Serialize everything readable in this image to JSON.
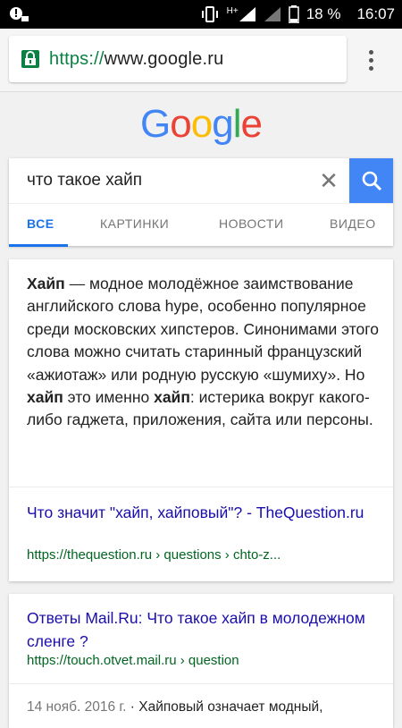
{
  "status_bar": {
    "icons": [
      "notification-icon",
      "vibrate-icon",
      "signal-icon",
      "wifi-icon",
      "battery-icon"
    ],
    "network": "H+",
    "battery": "18 %",
    "time": "16:07"
  },
  "browser": {
    "url_scheme": "https://",
    "url_host": "www.google.ru",
    "lock_color": "#0b8043"
  },
  "logo": {
    "letters": [
      "G",
      "o",
      "o",
      "g",
      "l",
      "e"
    ],
    "colors": [
      "#4285f4",
      "#ea4335",
      "#fbbc05",
      "#4285f4",
      "#34a853",
      "#ea4335"
    ]
  },
  "search": {
    "query": "что такое хайп",
    "clear_symbol": "✕",
    "accent": "#4285f4",
    "tabs": [
      {
        "label": "ВСЕ",
        "active": true
      },
      {
        "label": "КАРТИНКИ",
        "active": false
      },
      {
        "label": "НОВОСТИ",
        "active": false
      },
      {
        "label": "ВИДЕО",
        "active": false
      }
    ]
  },
  "results": {
    "snippet": {
      "term": "Хайп",
      "text1": " — модное молодёжное заимствование английского слова hype, особенно популярное среди московских хипстеров. Синонимами этого слова можно считать старинный французский «ажиотаж» или родную русскую «шумиху». Но ",
      "term2": "хайп",
      "text2": " это именно ",
      "term3": "хайп",
      "text3": ": истерика вокруг какого-либо гаджета, приложения, сайта или персоны."
    },
    "items": [
      {
        "title": "Что значит \"хайп, хайповый\"? - TheQuestion.ru",
        "url": "https://thequestion.ru › questions › chto-z..."
      },
      {
        "title": "Ответы Mail.Ru: Что такое хайп в молодежном сленге ?",
        "url": "https://touch.otvet.mail.ru › question",
        "date": "14 нояб. 2016 г.",
        "description": " · Хайповый означает модный,"
      }
    ]
  }
}
